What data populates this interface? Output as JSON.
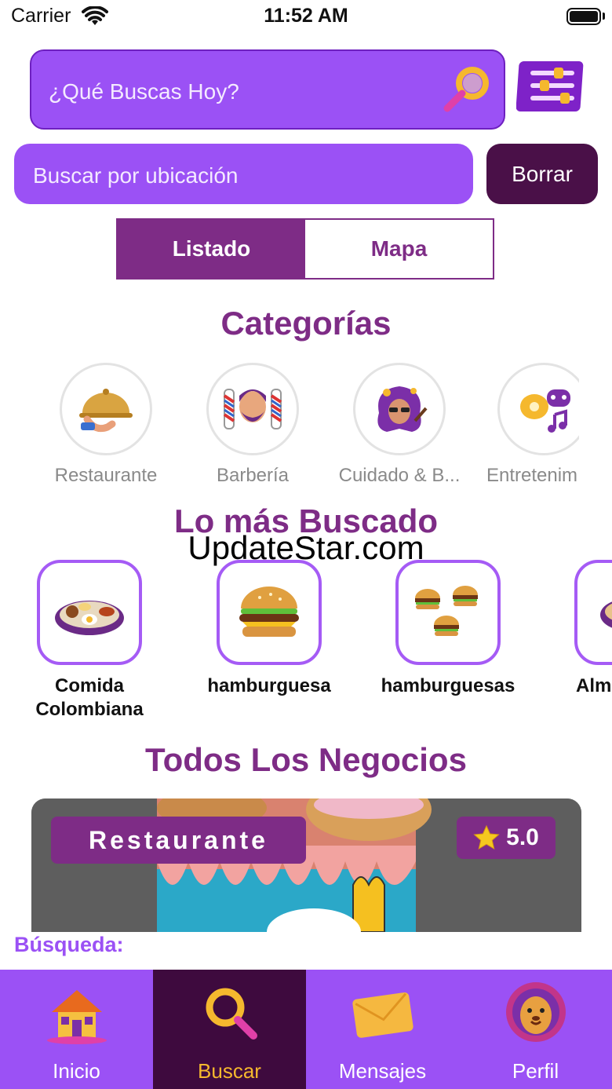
{
  "status_bar": {
    "carrier": "Carrier",
    "time": "11:52 AM"
  },
  "search": {
    "placeholder": "¿Qué Buscas Hoy?"
  },
  "location": {
    "placeholder": "Buscar por ubicación",
    "clear_label": "Borrar"
  },
  "view_toggle": {
    "list_label": "Listado",
    "map_label": "Mapa",
    "selected": "Listado"
  },
  "categories": {
    "title": "Categorías",
    "items": [
      {
        "label": "Restaurante",
        "icon": "cloche-icon"
      },
      {
        "label": "Barbería",
        "icon": "barber-icon"
      },
      {
        "label": "Cuidado & B...",
        "icon": "beauty-icon"
      },
      {
        "label": "Entretenim",
        "icon": "entertainment-icon"
      }
    ]
  },
  "watermark": "UpdateStar.com",
  "popular": {
    "title": "Lo más Buscado",
    "items": [
      {
        "label": "Comida Colombiana",
        "icon": "platter-icon"
      },
      {
        "label": "hamburguesa",
        "icon": "burger-icon"
      },
      {
        "label": "hamburguesas",
        "icon": "burgers-icon"
      },
      {
        "label": "Alm",
        "icon": "bowl-icon"
      }
    ]
  },
  "businesses": {
    "title": "Todos Los Negocios",
    "card": {
      "category": "Restaurante",
      "rating": "5.0"
    }
  },
  "search_label": "Búsqueda:",
  "nav": {
    "items": [
      {
        "label": "Inicio",
        "icon": "house-icon"
      },
      {
        "label": "Buscar",
        "icon": "search-icon"
      },
      {
        "label": "Mensajes",
        "icon": "envelope-icon"
      },
      {
        "label": "Perfil",
        "icon": "lion-icon"
      }
    ],
    "active": "Buscar"
  },
  "colors": {
    "primary": "#9b51f5",
    "accent": "#7e2c86",
    "dark": "#4a1048",
    "active_label": "#f5b82e"
  }
}
